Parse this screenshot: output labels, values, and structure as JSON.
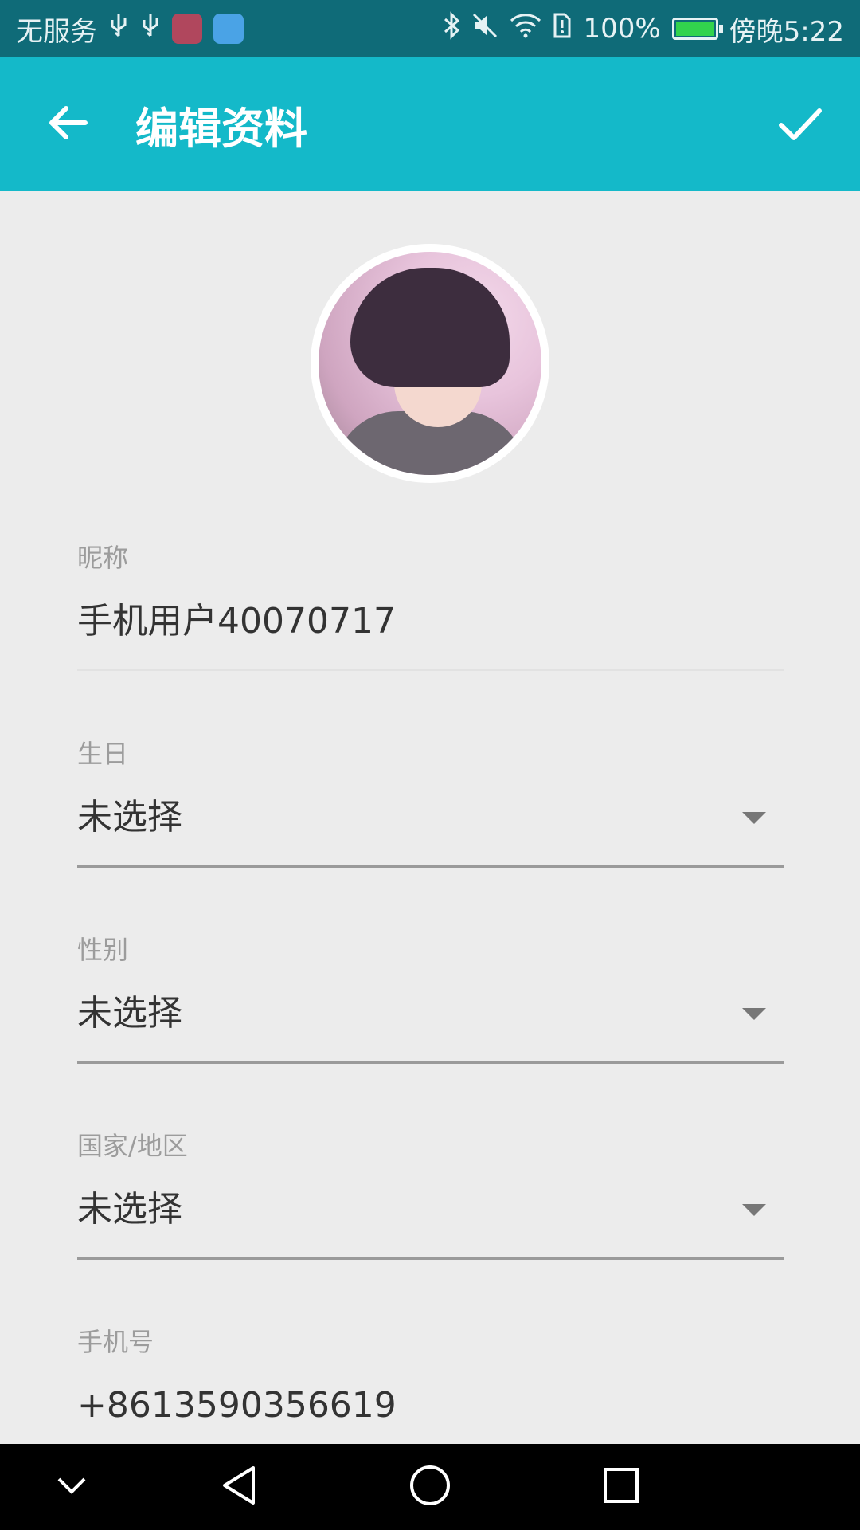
{
  "status_bar": {
    "carrier": "无服务",
    "battery_text": "100%",
    "time": "傍晚5:22",
    "icons": [
      "usb-icon",
      "usb-icon",
      "app-notification-icon",
      "app-notification-icon",
      "bluetooth-icon",
      "mute-icon",
      "wifi-icon",
      "sim-alert-icon",
      "battery-icon"
    ],
    "battery_level_percent": 100
  },
  "app_bar": {
    "title": "编辑资料",
    "back_icon": "arrow-left-icon",
    "confirm_icon": "check-icon",
    "background": "#14b9c9"
  },
  "form": {
    "nickname": {
      "label": "昵称",
      "value": "手机用户40070717"
    },
    "birthday": {
      "label": "生日",
      "value": "未选择"
    },
    "gender": {
      "label": "性别",
      "value": "未选择"
    },
    "region": {
      "label": "国家/地区",
      "value": "未选择"
    },
    "phone": {
      "label": "手机号",
      "value": "+8613590356619"
    }
  },
  "nav_bar": {
    "icons": [
      "chevron-down-icon",
      "back-triangle-icon",
      "home-circle-icon",
      "recents-square-icon"
    ]
  }
}
